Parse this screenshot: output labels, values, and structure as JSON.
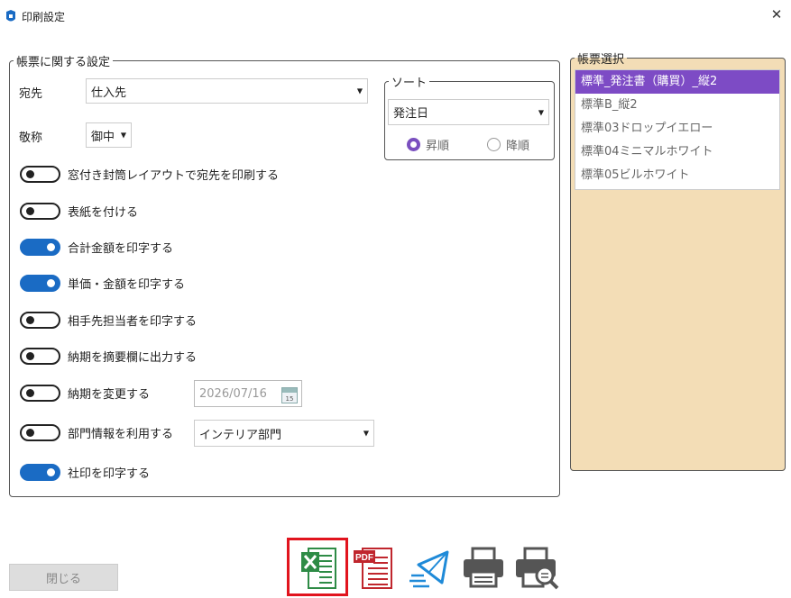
{
  "window": {
    "title": "印刷設定",
    "close_glyph": "✕"
  },
  "report_settings": {
    "legend": "帳票に関する設定",
    "recipient_label": "宛先",
    "recipient_value": "仕入先",
    "honorific_label": "敬称",
    "honorific_value": "御中",
    "toggles": [
      {
        "label": "窓付き封筒レイアウトで宛先を印刷する",
        "on": false
      },
      {
        "label": "表紙を付ける",
        "on": false
      },
      {
        "label": "合計金額を印字する",
        "on": true
      },
      {
        "label": "単価・金額を印字する",
        "on": true
      },
      {
        "label": "相手先担当者を印字する",
        "on": false
      },
      {
        "label": "納期を摘要欄に出力する",
        "on": false
      },
      {
        "label": "納期を変更する",
        "on": false
      },
      {
        "label": "部門情報を利用する",
        "on": false
      },
      {
        "label": "社印を印字する",
        "on": true
      }
    ],
    "due_date_value": "2026/07/16",
    "calendar_day": "15",
    "department_value": "インテリア部門"
  },
  "sort": {
    "legend": "ソート",
    "field_value": "発注日",
    "asc_label": "昇順",
    "desc_label": "降順",
    "selected": "asc"
  },
  "templates": {
    "legend": "帳票選択",
    "items": [
      "標準_発注書（購買）_縦2",
      "標準B_縦2",
      "標準03ドロップイエロー",
      "標準04ミニマルホワイト",
      "標準05ビルホワイト"
    ],
    "selected_index": 0
  },
  "footer": {
    "close_label": "閉じる",
    "icons": [
      "excel-icon",
      "pdf-icon",
      "mail-icon",
      "printer-icon",
      "print-preview-icon"
    ],
    "pdf_badge": "PDF"
  },
  "colors": {
    "accent": "#7d4bc5",
    "toggle_on": "#1a6bc4",
    "panel": "#f3ddb6",
    "highlight": "#e1141e"
  }
}
